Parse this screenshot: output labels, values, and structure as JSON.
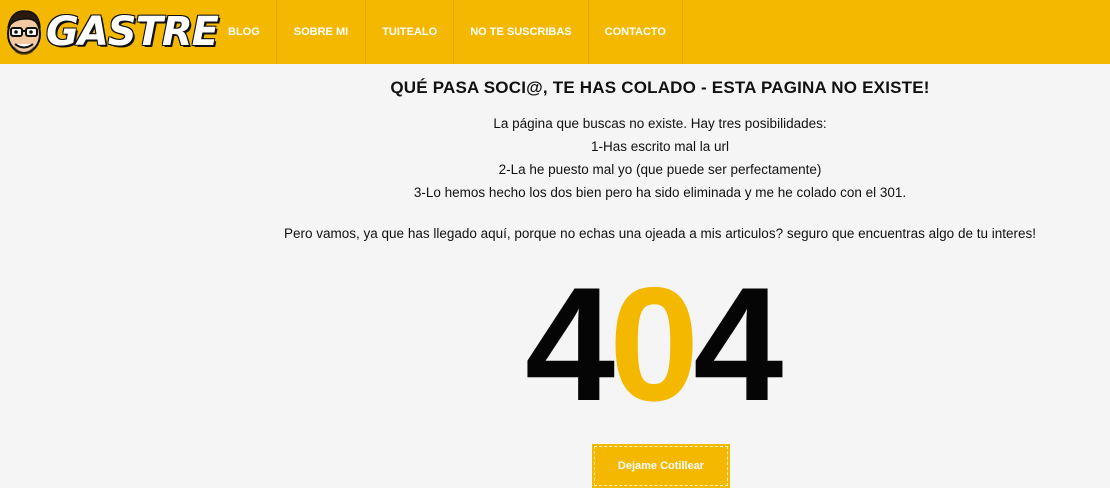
{
  "header": {
    "logo_text": "GASTRE",
    "nav": [
      {
        "label": "BLOG"
      },
      {
        "label": "SOBRE MI"
      },
      {
        "label": "TUITEALO"
      },
      {
        "label": "NO TE SUSCRIBAS"
      },
      {
        "label": "CONTACTO"
      }
    ]
  },
  "main": {
    "title": "QUÉ PASA SOCI@, TE HAS COLADO - ESTA PAGINA NO EXISTE!",
    "intro": "La página que buscas no existe. Hay tres posibilidades:",
    "option1": "1-Has escrito mal la url",
    "option2": "2-La he puesto mal yo (que puede ser perfectamente)",
    "option3": "3-Lo hemos hecho los dos bien pero ha sido eliminada y me he colado con el 301.",
    "extra": "Pero vamos, ya que has llegado aquí, porque no echas una ojeada a mis articulos? seguro que encuentras algo de tu interes!",
    "code_first": "4",
    "code_middle": "0",
    "code_last": "4",
    "button_label": "Dejame Cotillear"
  },
  "colors": {
    "accent": "#f5b800",
    "background": "#f5f5f5",
    "text": "#111111"
  }
}
